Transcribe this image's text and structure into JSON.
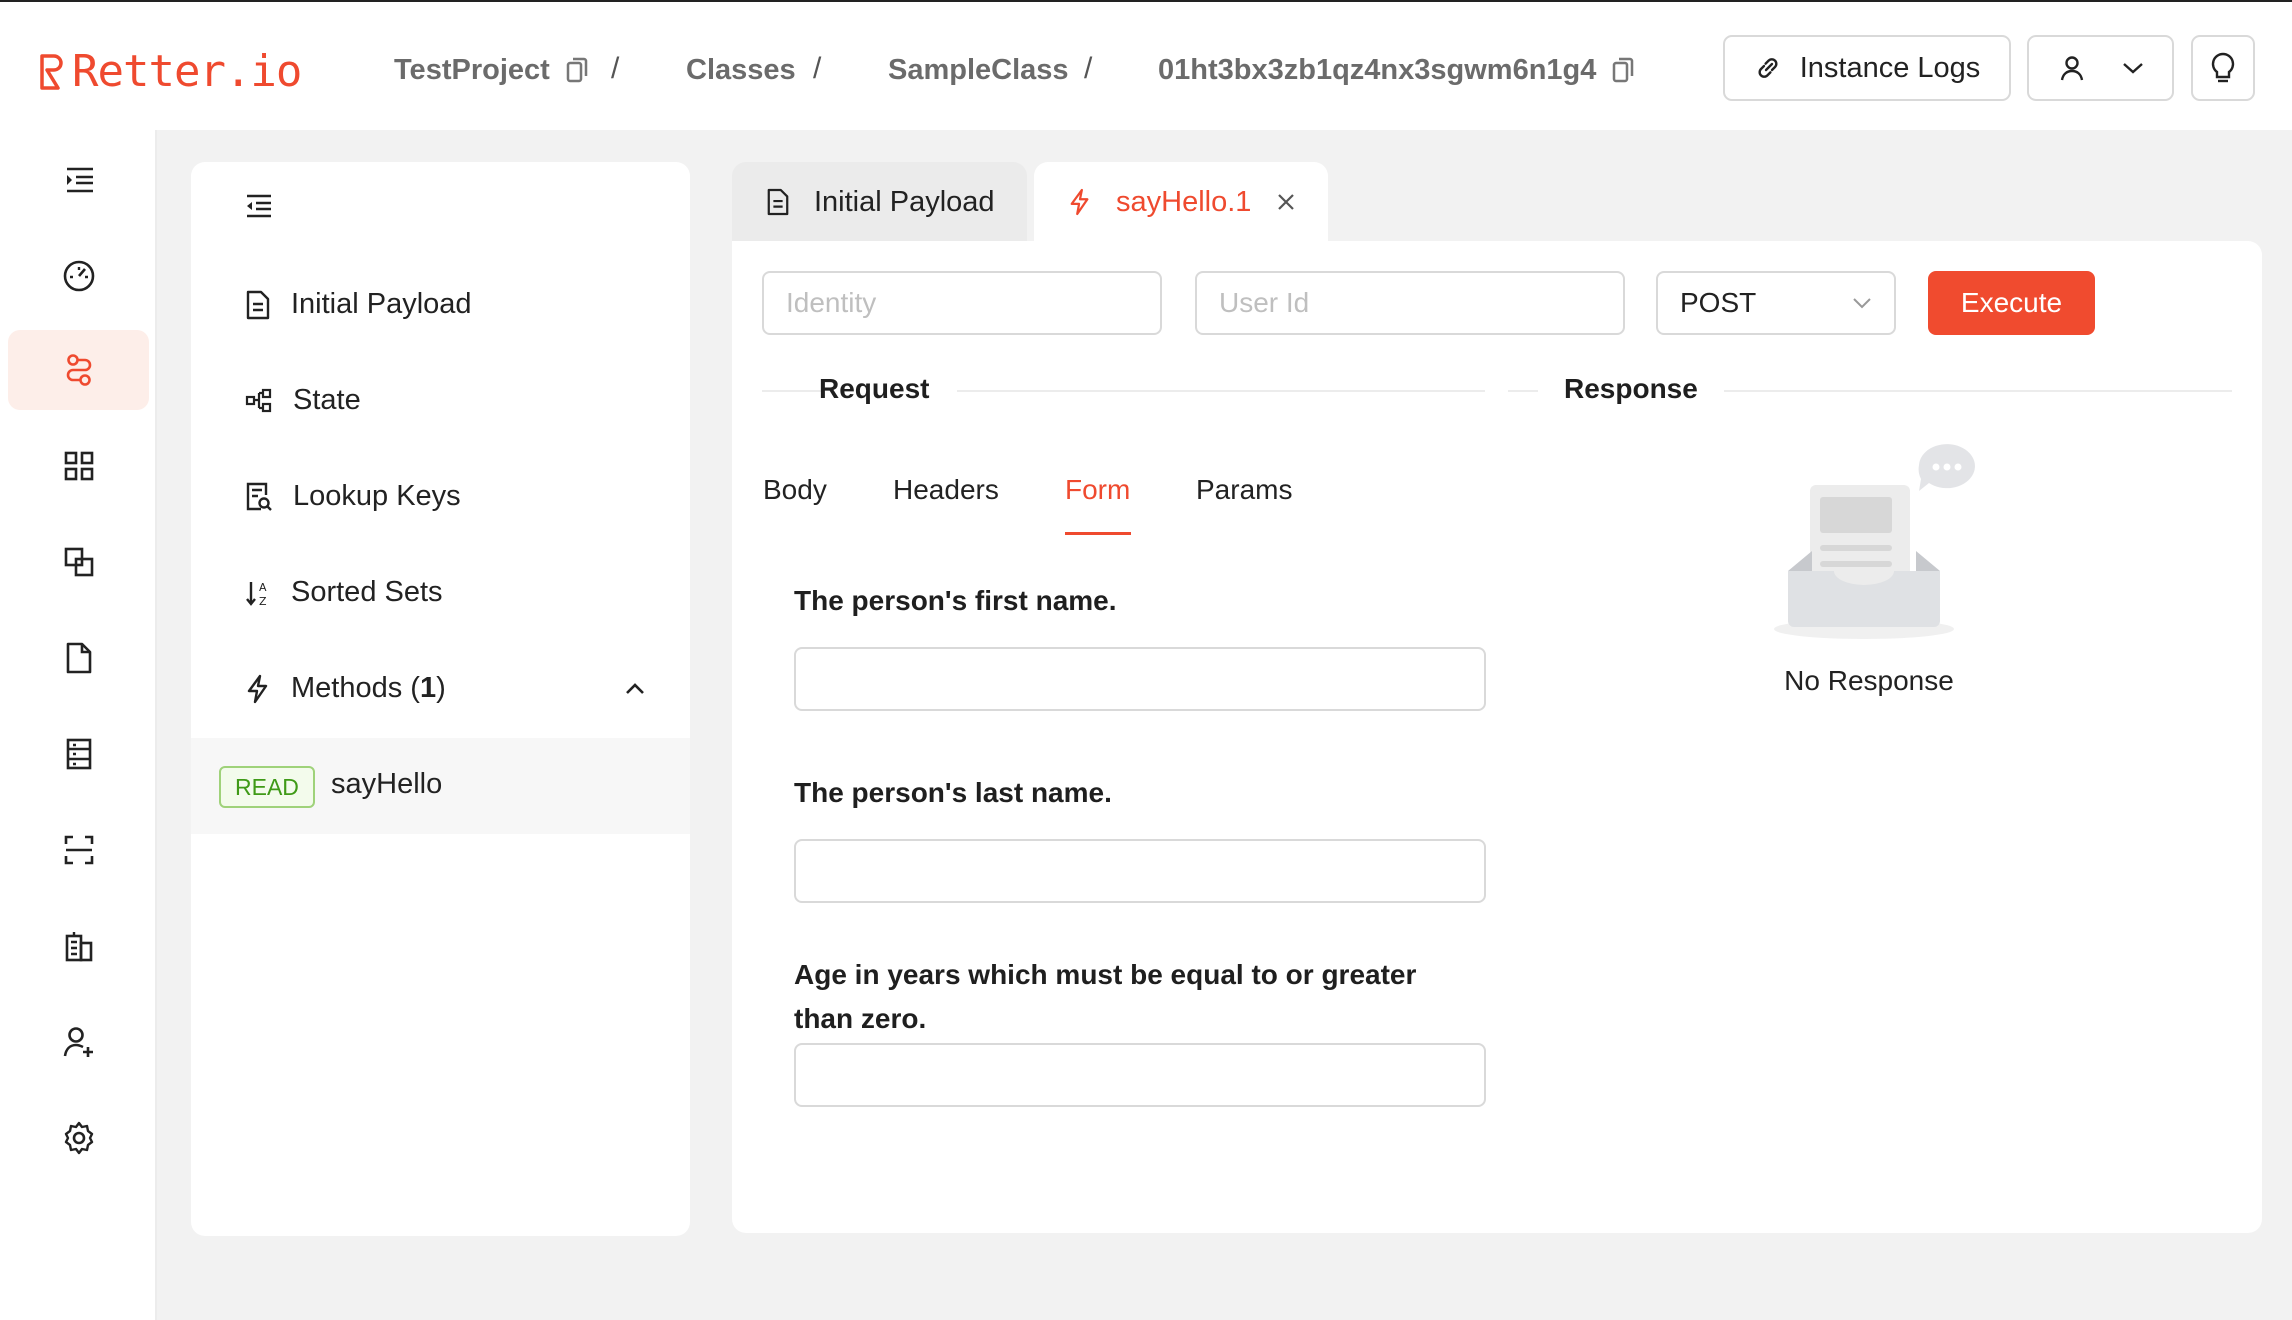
{
  "app": {
    "logo_text": "Retter.io",
    "brand_color": "#ef4a2f"
  },
  "breadcrumb": {
    "project": "TestProject",
    "classes": "Classes",
    "class_name": "SampleClass",
    "instance_id": "01ht3bx3zb1qz4nx3sgwm6n1g4",
    "separator": "/"
  },
  "header": {
    "instance_logs": "Instance Logs",
    "icons": [
      "link-icon",
      "user-icon",
      "chevron-down-icon",
      "lightbulb-icon"
    ]
  },
  "rail": {
    "items": [
      "expand-menu-icon",
      "dashboard-icon",
      "classes-icon",
      "apps-icon",
      "instances-icon",
      "file-icon",
      "database-icon",
      "scan-icon",
      "building-icon",
      "user-add-icon",
      "settings-icon"
    ],
    "active": "classes-icon"
  },
  "panel": {
    "items": [
      "Initial Payload",
      "State",
      "Lookup Keys",
      "Sorted Sets"
    ],
    "methods_label": "Methods",
    "methods_count": "1",
    "method": {
      "tag": "READ",
      "name": "sayHello"
    }
  },
  "tabs": [
    {
      "label": "Initial Payload",
      "active": false
    },
    {
      "label": "sayHello.1",
      "active": true
    }
  ],
  "request_bar": {
    "identity_placeholder": "Identity",
    "user_id_placeholder": "User Id",
    "method_value": "POST",
    "execute_label": "Execute"
  },
  "request": {
    "title": "Request",
    "subtabs": [
      "Body",
      "Headers",
      "Form",
      "Params"
    ],
    "active_subtab": "Form",
    "fields": [
      {
        "label": "The person's first name.",
        "value": ""
      },
      {
        "label": "The person's last name.",
        "value": ""
      },
      {
        "label": "Age in years which must be equal to or greater than zero.",
        "value": ""
      }
    ]
  },
  "response": {
    "title": "Response",
    "empty_text": "No Response"
  }
}
